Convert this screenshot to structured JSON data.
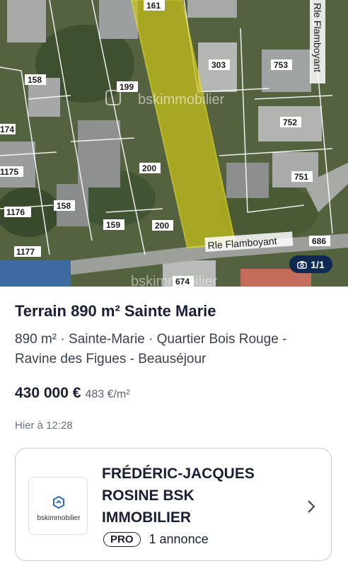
{
  "photo": {
    "watermark_top": "bskimmobilier",
    "watermark_bottom": "bskimmobilier",
    "parcel_numbers": [
      "161",
      "303",
      "753",
      "158",
      "199",
      "752",
      "174",
      "200",
      "751",
      "1175",
      "158",
      "1176",
      "159",
      "200",
      "686",
      "1177",
      "674"
    ],
    "street_right": "Rle Flamboyant",
    "street_bottom": "Rle Flamboyant",
    "counter": "1/1"
  },
  "listing": {
    "title": "Terrain 890 m² Sainte Marie",
    "subtitle": "890 m² · Sainte-Marie · Quartier Bois Rouge - Ravine des Figues - Beauséjour",
    "price": "430 000 €",
    "price_per_m2": "483 €/m²",
    "date": "Hier à 12:28"
  },
  "agency": {
    "logo_text": "bskimmobilier",
    "name": "FRÉDÉRIC-JACQUES ROSINE BSK IMMOBILIER",
    "badge": "PRO",
    "listings_count": "1 annonce"
  }
}
